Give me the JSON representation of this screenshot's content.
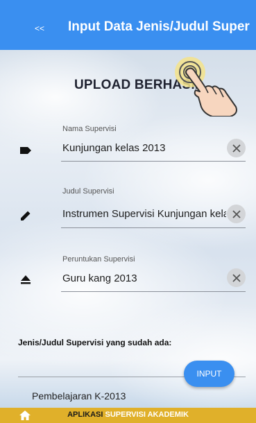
{
  "appbar": {
    "back_label": "<<",
    "title": "Input Data Jenis/Judul Super..."
  },
  "status": {
    "upload_text": "UPLOAD BERHASIL"
  },
  "fields": [
    {
      "label": "Nama Supervisi",
      "value": "Kunjungan kelas 2013",
      "icon": "label-icon"
    },
    {
      "label": "Judul Supervisi",
      "value": "Instrumen Supervisi Kunjungan kelas",
      "icon": "pencil-icon"
    },
    {
      "label": "Peruntukan Supervisi",
      "value": "Guru kang 2013",
      "icon": "eject-icon"
    }
  ],
  "list": {
    "title": "Jenis/Judul Supervisi yang sudah ada:",
    "input_button": "INPUT",
    "items": [
      "Pembelajaran K-2013"
    ]
  },
  "footer": {
    "text_part1": "APLIKASI",
    "text_part2": "SUPERVISI AKADEMIK",
    "home_icon": "home-icon"
  },
  "colors": {
    "primary": "#3a8ff0",
    "footer": "#e0b02a"
  }
}
